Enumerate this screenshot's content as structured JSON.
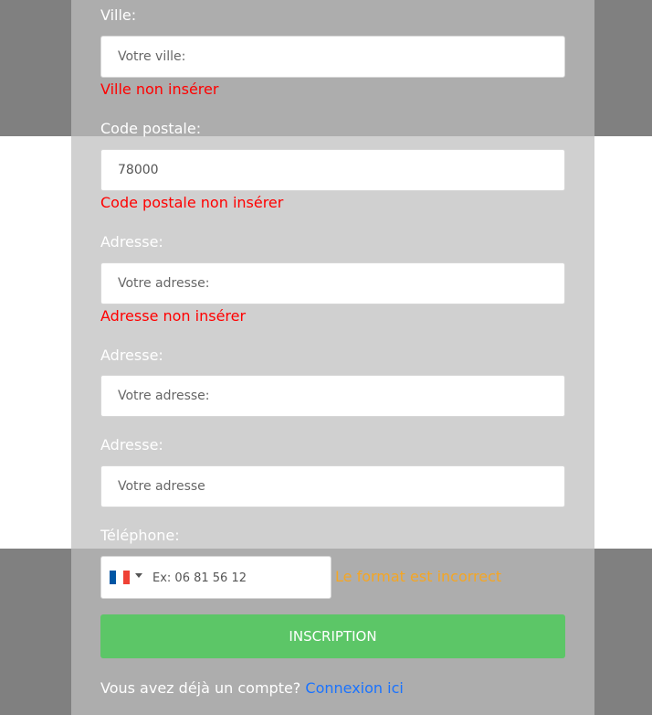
{
  "form": {
    "ville": {
      "label": "Ville:",
      "placeholder": "Votre ville:",
      "value": "",
      "error": "Ville non insérer"
    },
    "code_postal": {
      "label": "Code postale:",
      "placeholder": "",
      "value": "78000",
      "error": "Code postale non insérer"
    },
    "adresse1": {
      "label": "Adresse:",
      "placeholder": "Votre adresse:",
      "value": "",
      "error": "Adresse non insérer"
    },
    "adresse2": {
      "label": "Adresse:",
      "placeholder": "Votre adresse:",
      "value": ""
    },
    "adresse3": {
      "label": "Adresse:",
      "placeholder": "Votre adresse",
      "value": ""
    },
    "telephone": {
      "label": "Téléphone:",
      "placeholder": "Ex: 06 81 56 12",
      "value": "",
      "country_icon": "france-flag-icon",
      "flag_colors": [
        "#0055a4",
        "#ffffff",
        "#ef4135"
      ],
      "warning": "Le format est incorrect",
      "warning_color": "#f5a623"
    },
    "submit_label": "INSCRIPTION",
    "submit_color": "#5cc667",
    "error_color": "#ff0000"
  },
  "footer": {
    "text": "Vous avez déjà un compte?",
    "link_label": "Connexion ici",
    "link_color": "#1a73ff"
  }
}
